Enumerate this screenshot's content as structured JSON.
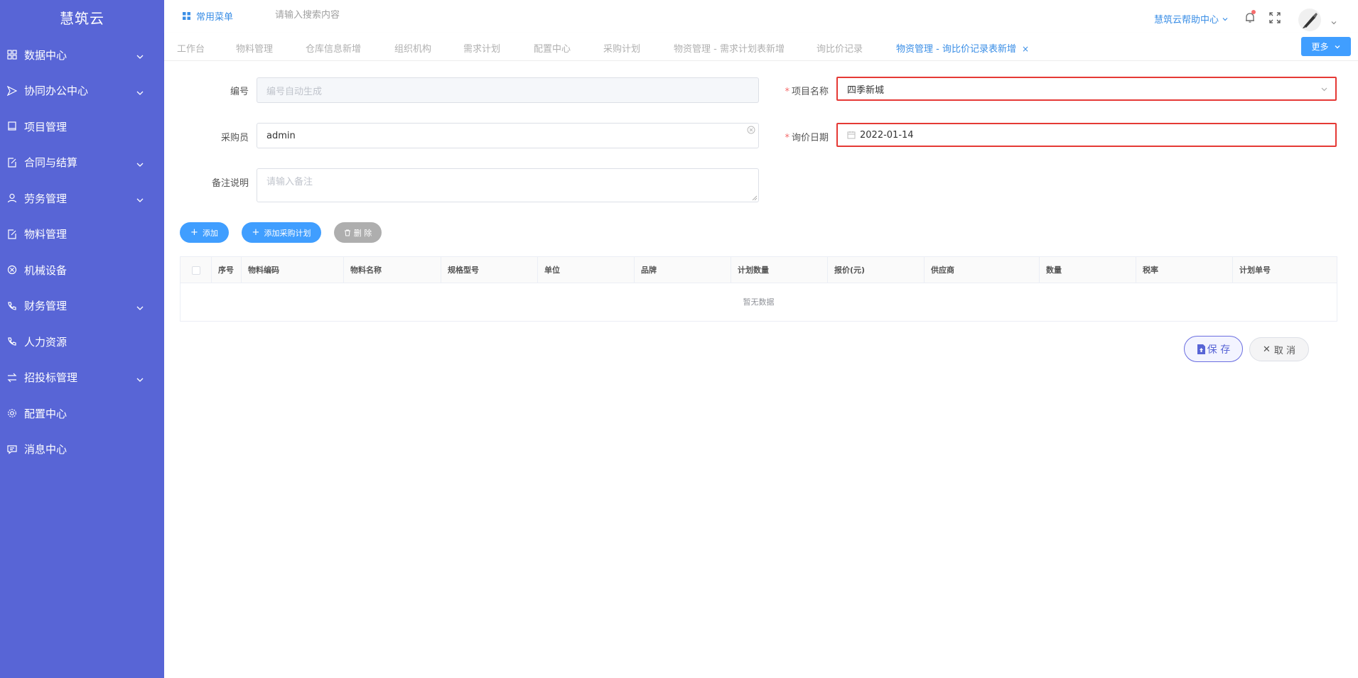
{
  "brand": {
    "title": "慧筑云"
  },
  "sidebar": {
    "items": [
      {
        "label": "数据中心",
        "icon": "grid-icon",
        "has_children": true
      },
      {
        "label": "协同办公中心",
        "icon": "send-icon",
        "has_children": true
      },
      {
        "label": "项目管理",
        "icon": "book-icon",
        "has_children": false
      },
      {
        "label": "合同与结算",
        "icon": "edit-doc-icon",
        "has_children": true
      },
      {
        "label": "劳务管理",
        "icon": "user-icon",
        "has_children": true
      },
      {
        "label": "物料管理",
        "icon": "edit-doc-icon",
        "has_children": false
      },
      {
        "label": "机械设备",
        "icon": "circle-x-icon",
        "has_children": false
      },
      {
        "label": "财务管理",
        "icon": "phone-icon",
        "has_children": true
      },
      {
        "label": "人力资源",
        "icon": "phone-icon",
        "has_children": false
      },
      {
        "label": "招投标管理",
        "icon": "transfer-icon",
        "has_children": true
      },
      {
        "label": "配置中心",
        "icon": "gear-icon",
        "has_children": false
      },
      {
        "label": "消息中心",
        "icon": "message-icon",
        "has_children": false
      }
    ]
  },
  "header": {
    "fav_menu_label": "常用菜单",
    "search_placeholder": "请输入搜索内容",
    "help_label": "慧筑云帮助中心"
  },
  "tabs": {
    "items": [
      {
        "label": "工作台",
        "active": false
      },
      {
        "label": "物料管理",
        "active": false
      },
      {
        "label": "仓库信息新增",
        "active": false
      },
      {
        "label": "组织机构",
        "active": false
      },
      {
        "label": "需求计划",
        "active": false
      },
      {
        "label": "配置中心",
        "active": false
      },
      {
        "label": "采购计划",
        "active": false
      },
      {
        "label": "物资管理 - 需求计划表新增",
        "active": false
      },
      {
        "label": "询比价记录",
        "active": false
      },
      {
        "label": "物资管理 - 询比价记录表新增",
        "active": true
      }
    ],
    "close_symbol": "×",
    "more_label": "更多"
  },
  "form": {
    "code_label": "编号",
    "code_placeholder": "编号自动生成",
    "project_label": "项目名称",
    "project_value": "四季新城",
    "buyer_label": "采购员",
    "buyer_value": "admin",
    "date_label": "询价日期",
    "date_value": "2022-01-14",
    "remark_label": "备注说明",
    "remark_placeholder": "请输入备注",
    "required_mark": "*"
  },
  "actions": {
    "add_label": "添加",
    "add_plan_label": "添加采购计划",
    "delete_label": "删 除"
  },
  "table": {
    "columns": [
      "序号",
      "物料编码",
      "物料名称",
      "规格型号",
      "单位",
      "品牌",
      "计划数量",
      "报价(元)",
      "供应商",
      "数量",
      "税率",
      "计划单号"
    ],
    "empty_text": "暂无数据"
  },
  "footer": {
    "save_label": "保 存",
    "cancel_label": "取 消"
  },
  "colors": {
    "sidebar_bg": "#5865d6",
    "accent": "#409eff",
    "highlight_border": "#e53935"
  }
}
